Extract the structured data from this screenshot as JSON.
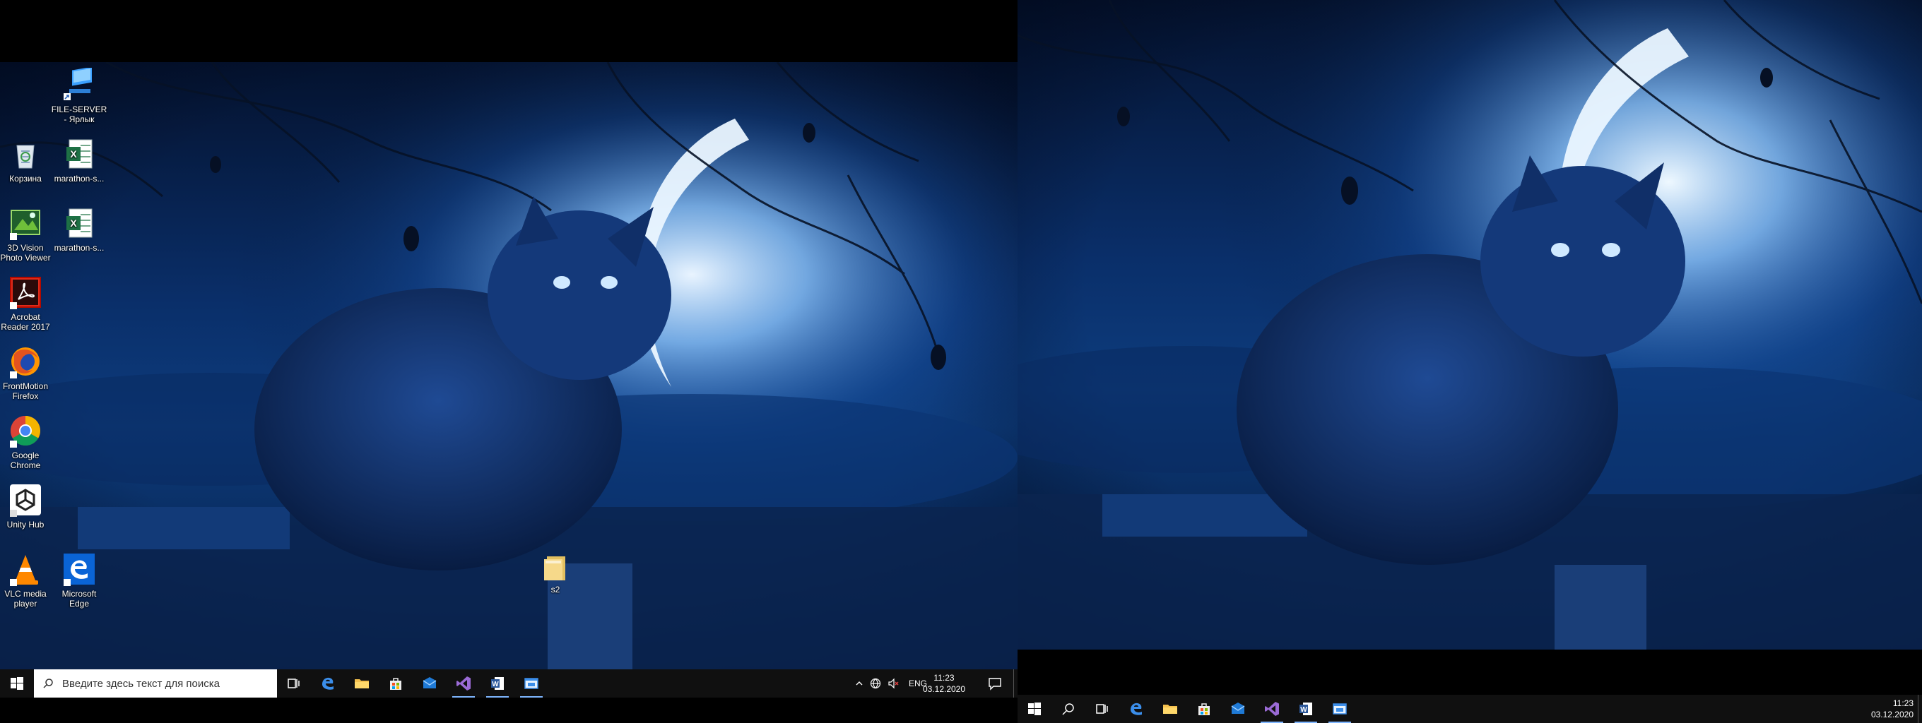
{
  "desktop_icons": [
    {
      "label": "FILE-SERVER - Ярлык",
      "icon": "network-computer-shortcut-icon"
    },
    {
      "label": "Корзина",
      "icon": "recycle-bin-icon"
    },
    {
      "label": "marathon-s...",
      "icon": "excel-file-icon"
    },
    {
      "label": "3D Vision Photo Viewer",
      "icon": "3d-vision-icon"
    },
    {
      "label": "marathon-s...",
      "icon": "excel-file-icon"
    },
    {
      "label": "Acrobat Reader 2017",
      "icon": "acrobat-icon"
    },
    {
      "label": "FrontMotion Firefox",
      "icon": "firefox-icon"
    },
    {
      "label": "Google Chrome",
      "icon": "chrome-icon"
    },
    {
      "label": "Unity Hub",
      "icon": "unity-icon"
    },
    {
      "label": "VLC media player",
      "icon": "vlc-icon"
    },
    {
      "label": "Microsoft Edge",
      "icon": "edge-icon"
    },
    {
      "label": "s2",
      "icon": "folder-icon"
    }
  ],
  "taskbar1": {
    "search_placeholder": "Введите здесь текст для поиска",
    "pinned": [
      "task-view",
      "edge",
      "file-explorer",
      "store",
      "mail",
      "visual-studio",
      "word",
      "app-window"
    ],
    "language": "ENG",
    "time": "11:23",
    "date": "03.12.2020"
  },
  "taskbar2": {
    "pinned": [
      "search",
      "task-view",
      "edge",
      "file-explorer",
      "store",
      "mail",
      "visual-studio",
      "word",
      "app-window"
    ],
    "time": "11:23",
    "date": "03.12.2020"
  },
  "colors": {
    "taskbar": "#101010",
    "active_indicator": "#7fb6ff",
    "wallpaper_deep": "#04122e",
    "wallpaper_mid": "#0d3c7d"
  }
}
